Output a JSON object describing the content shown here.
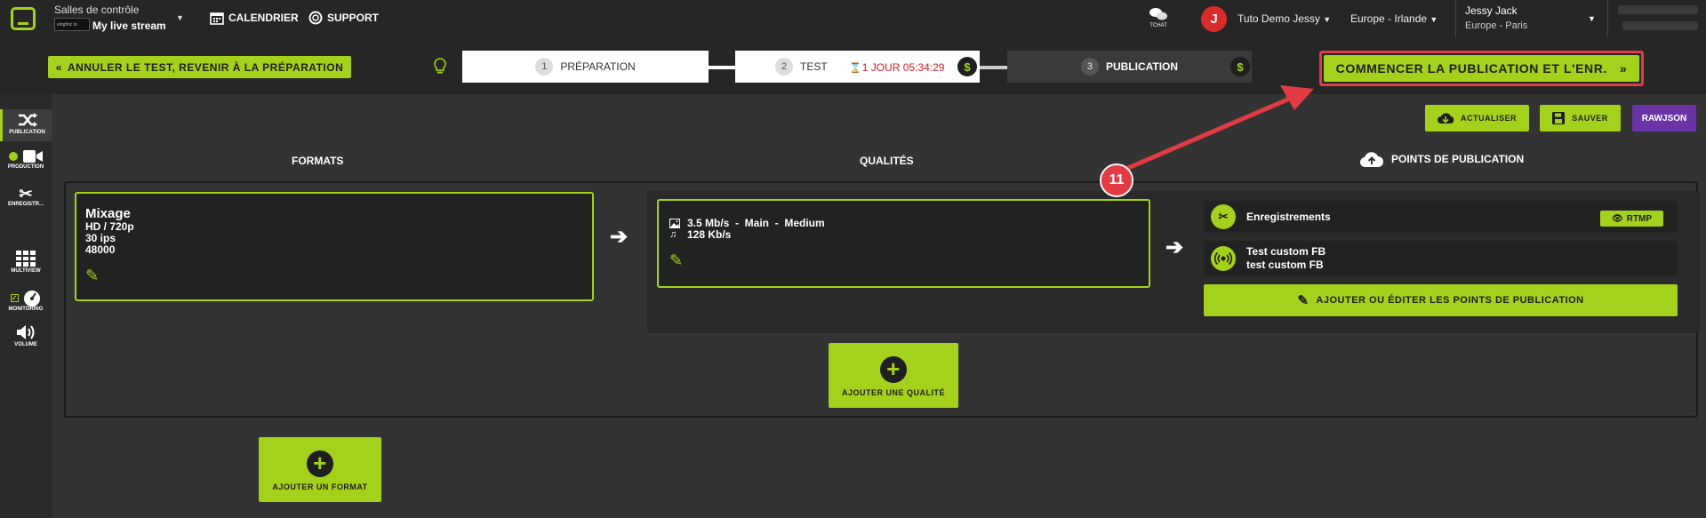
{
  "header": {
    "room_title": "Salles de contrôle",
    "room_thumb_text": "elogfnic to",
    "room_name": "My live stream",
    "calendar": "CALENDRIER",
    "support": "SUPPORT",
    "chat": "TCHAT",
    "avatar_letter": "J",
    "org": "Tuto Demo Jessy",
    "region": "Europe - Irlande",
    "user_name": "Jessy Jack",
    "user_tz": "Europe - Paris"
  },
  "steps": {
    "cancel": "ANNULER LE TEST, REVENIR À LA PRÉPARATION",
    "items": [
      {
        "num": "1",
        "label": "PRÉPARATION"
      },
      {
        "num": "2",
        "label": "TEST"
      },
      {
        "num": "3",
        "label": "PUBLICATION"
      }
    ],
    "timer": "1 JOUR 05:34:29",
    "dollar": "$",
    "publish": "COMMENCER LA PUBLICATION ET L'ENR."
  },
  "rail": {
    "publication": "PUBLICATION",
    "production": "PRODUCTION",
    "enregistr": "ENREGISTR...",
    "multiview": "MULTIVIEW",
    "monitoring": "MONITORING",
    "volume": "VOLUME"
  },
  "actions": {
    "actualiser": "ACTUALISER",
    "sauver": "SAUVER",
    "rawjson": "RAWJSON"
  },
  "columns": {
    "formats": "FORMATS",
    "qualites": "QUALITÉS",
    "points": "POINTS DE PUBLICATION"
  },
  "format": {
    "title": "Mixage",
    "line1": "HD / 720p",
    "line2": "30 ips",
    "line3": "48000"
  },
  "quality": {
    "video": "3.5 Mb/s  -  Main  -  Medium",
    "audio": "128 Kb/s"
  },
  "points": {
    "item1": "Enregistrements",
    "rtmp": "RTMP",
    "item2_line1": "Test custom FB",
    "item2_line2": "test custom FB",
    "add": "AJOUTER OU ÉDITER LES POINTS DE PUBLICATION"
  },
  "add_quality": "AJOUTER UNE QUALITÉ",
  "add_format": "AJOUTER UN FORMAT",
  "callout": "11",
  "colors": {
    "accent": "#a4d11b",
    "callout": "#e23b44",
    "rawjson": "#6a34a6",
    "timer": "#cc2222"
  }
}
